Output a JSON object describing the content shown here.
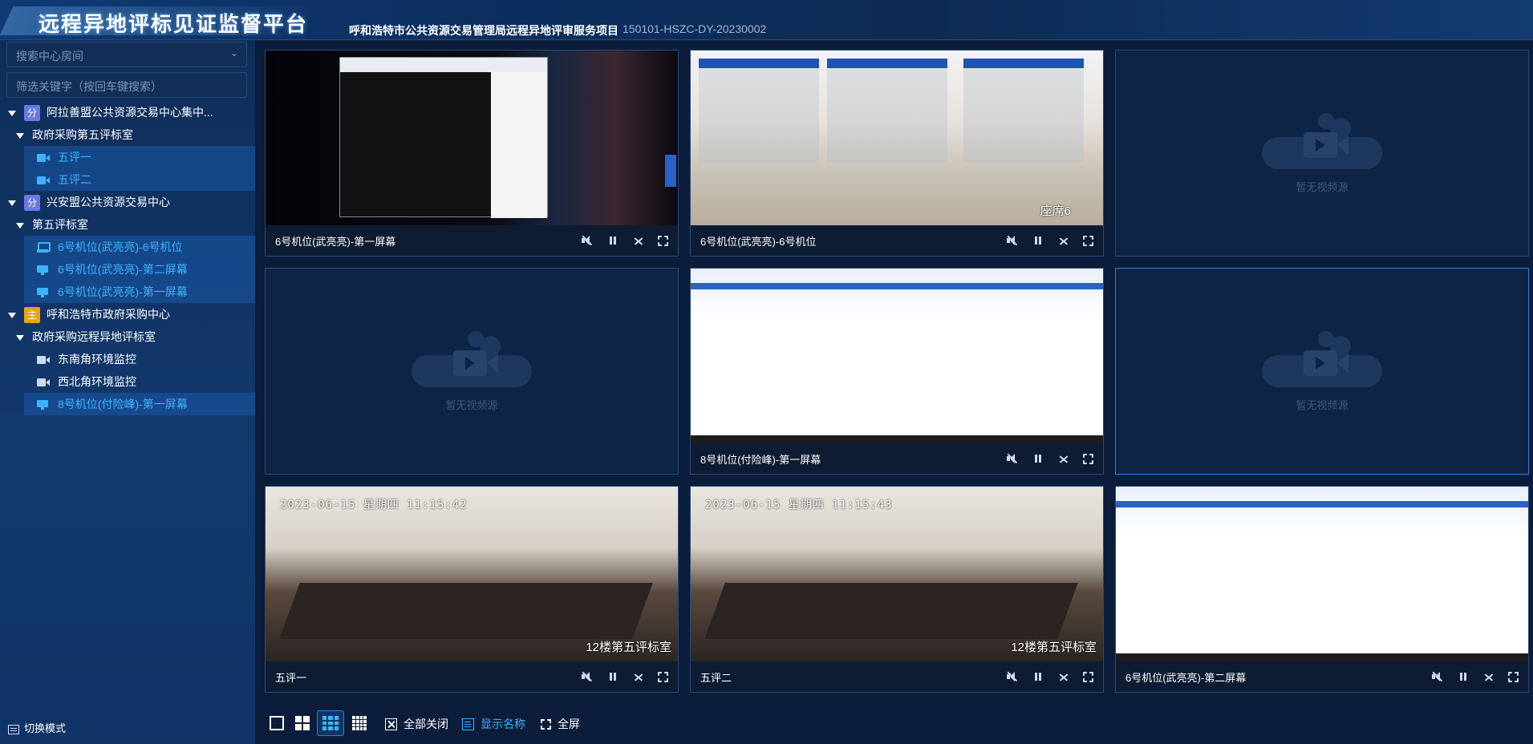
{
  "header": {
    "app_title": "远程异地评标见证监督平台",
    "project_name": "呼和浩特市公共资源交易管理局远程异地评审服务项目",
    "project_code": "150101-HSZC-DY-20230002"
  },
  "sidebar": {
    "room_select_placeholder": "搜索中心房间",
    "filter_placeholder": "筛选关键字（按回车键搜索）",
    "tree": [
      {
        "label": "阿拉善盟公共资源交易中心集中...",
        "badge": "分"
      },
      {
        "label": "政府采购第五评标室"
      },
      {
        "label": "五评一"
      },
      {
        "label": "五评二"
      },
      {
        "label": "兴安盟公共资源交易中心",
        "badge": "分"
      },
      {
        "label": "第五评标室"
      },
      {
        "label": "6号机位(武亮亮)-6号机位"
      },
      {
        "label": "6号机位(武亮亮)-第二屏幕"
      },
      {
        "label": "6号机位(武亮亮)-第一屏幕"
      },
      {
        "label": "呼和浩特市政府采购中心",
        "badge": "主"
      },
      {
        "label": "政府采购远程异地评标室"
      },
      {
        "label": "东南角环境监控"
      },
      {
        "label": "西北角环境监控"
      },
      {
        "label": "8号机位(付险峰)-第一屏幕"
      }
    ],
    "switch_mode": "切换模式"
  },
  "tiles": [
    {
      "label": "6号机位(武亮亮)-第一屏幕"
    },
    {
      "label": "6号机位(武亮亮)-6号机位",
      "overlay": "座席6"
    },
    {
      "empty_text": "暂无视频源"
    },
    {
      "empty_text": "暂无视频源"
    },
    {
      "label": "8号机位(付险峰)-第一屏幕"
    },
    {
      "empty_text": "暂无视频源"
    },
    {
      "label": "五评一",
      "timestamp": "2023-06-15  星期四  11:15:42",
      "caption": "12楼第五评标室"
    },
    {
      "label": "五评二",
      "timestamp": "2023-06-15  星期四  11:15:43",
      "caption": "12楼第五评标室"
    },
    {
      "label": "6号机位(武亮亮)-第二屏幕"
    }
  ],
  "toolbar": {
    "close_all": "全部关闭",
    "show_names": "显示名称",
    "fullscreen": "全屏"
  },
  "colors": {
    "accent": "#3fb3ff",
    "background": "#0b1d3a",
    "badge_fen": "#6a78e6",
    "badge_zhu": "#f0a11a"
  }
}
